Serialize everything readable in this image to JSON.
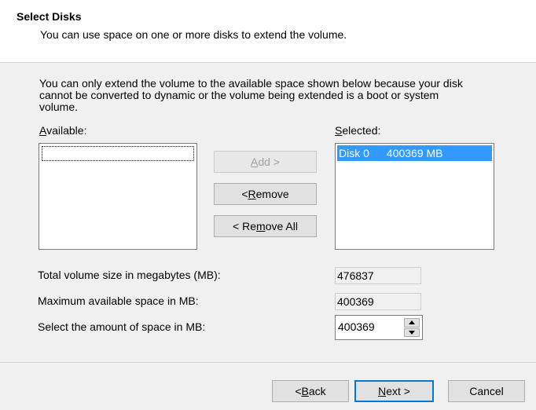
{
  "header": {
    "title": "Select Disks",
    "subtitle": "You can use space on one or more disks to extend the volume."
  },
  "info_text": {
    "line1": "You can only extend the volume to the available space shown below because your disk",
    "line2": "cannot be converted to dynamic or the volume being extended is a boot or system",
    "line3": "volume."
  },
  "available": {
    "label_prefix": "",
    "label_mnemonic": "A",
    "label_suffix": "vailable:"
  },
  "selected": {
    "label_prefix": "",
    "label_mnemonic": "S",
    "label_suffix": "elected:",
    "items": [
      {
        "disk": "Disk 0",
        "size": "400369 MB"
      }
    ]
  },
  "buttons": {
    "add": {
      "pre": "",
      "mn": "A",
      "post": "dd >"
    },
    "remove": {
      "pre": "< ",
      "mn": "R",
      "post": "emove"
    },
    "remove_all": {
      "pre": "< Re",
      "mn": "m",
      "post": "ove All"
    },
    "back": {
      "pre": "< ",
      "mn": "B",
      "post": "ack"
    },
    "next": {
      "pre": "",
      "mn": "N",
      "post": "ext >"
    },
    "cancel": "Cancel"
  },
  "fields": {
    "total_label": "Total volume size in megabytes (MB):",
    "total_value": "476837",
    "max_label": "Maximum available space in MB:",
    "max_value": "400369",
    "select_label_pre": "Select the amount of space in MB:",
    "select_value": "400369"
  },
  "icons": {
    "spin_up": "spin-up-arrow-icon",
    "spin_down": "spin-down-arrow-icon"
  }
}
